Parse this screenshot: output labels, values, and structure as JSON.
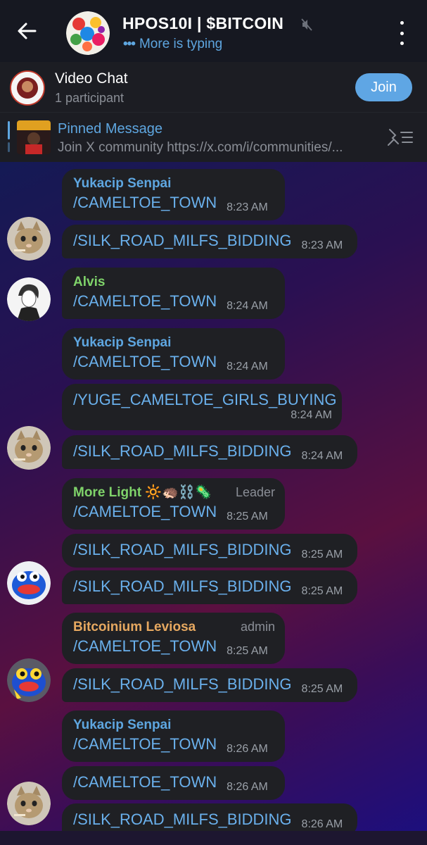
{
  "header": {
    "title": "HPOS10I | $BITCOIN",
    "status": "More is typing",
    "typing_dots": "•••"
  },
  "video_chat": {
    "title": "Video Chat",
    "subtitle": "1 participant",
    "join_label": "Join"
  },
  "pinned": {
    "title": "Pinned Message",
    "text": "Join X community  https://x.com/i/communities/..."
  },
  "colors": {
    "accent": "#5ea6e0",
    "sender_blue": "#5ea6e0",
    "sender_green": "#7fd36a",
    "sender_orange": "#e6a860",
    "bubble": "#1f2024"
  },
  "messages": [
    {
      "sender": "Yukacip Senpai",
      "text": "/CAMELTOE_TOWN",
      "time": "8:23 AM"
    },
    {
      "text": "/SILK_ROAD_MILFS_BIDDING",
      "time": "8:23 AM"
    },
    {
      "sender": "Alvis",
      "text": "/CAMELTOE_TOWN",
      "time": "8:24 AM"
    },
    {
      "sender": "Yukacip Senpai",
      "text": "/CAMELTOE_TOWN",
      "time": "8:24 AM"
    },
    {
      "text": "/YUGE_CAMELTOE_GIRLS_BUYING",
      "time": "8:24 AM"
    },
    {
      "text": "/SILK_ROAD_MILFS_BIDDING",
      "time": "8:24 AM"
    },
    {
      "sender": "More Light 🔆🦔⛓️🦠",
      "role": "Leader",
      "text": "/CAMELTOE_TOWN",
      "time": "8:25 AM"
    },
    {
      "text": "/SILK_ROAD_MILFS_BIDDING",
      "time": "8:25 AM"
    },
    {
      "text": "/SILK_ROAD_MILFS_BIDDING",
      "time": "8:25 AM"
    },
    {
      "sender": "Bitcoinium Leviosa",
      "role": "admin",
      "text": "/CAMELTOE_TOWN",
      "time": "8:25 AM"
    },
    {
      "text": "/SILK_ROAD_MILFS_BIDDING",
      "time": "8:25 AM"
    },
    {
      "sender": "Yukacip Senpai",
      "text": "/CAMELTOE_TOWN",
      "time": "8:26 AM"
    },
    {
      "text": "/CAMELTOE_TOWN",
      "time": "8:26 AM"
    },
    {
      "text": "/SILK_ROAD_MILFS_BIDDING",
      "time": "8:26 AM"
    }
  ]
}
